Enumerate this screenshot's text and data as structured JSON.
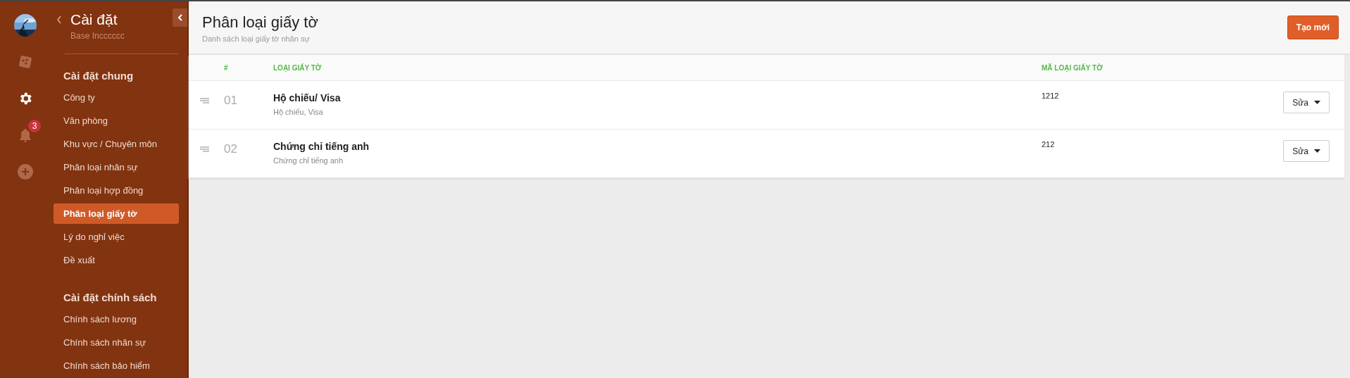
{
  "rail": {
    "items": [
      {
        "kind": "avatar",
        "selected": false
      },
      {
        "kind": "apps",
        "selected": false
      },
      {
        "kind": "settings",
        "selected": true
      },
      {
        "kind": "bell",
        "selected": false,
        "badge": "3"
      },
      {
        "kind": "add",
        "selected": false
      }
    ]
  },
  "sidebar": {
    "title": "Cài đặt",
    "subtitle": "Base Incccccc",
    "sections": [
      {
        "title": "Cài đặt chung",
        "items": [
          {
            "label": "Công ty",
            "selected": false
          },
          {
            "label": "Văn phòng",
            "selected": false
          },
          {
            "label": "Khu vực / Chuyên môn",
            "selected": false
          },
          {
            "label": "Phân loại nhân sự",
            "selected": false
          },
          {
            "label": "Phân loại hợp đồng",
            "selected": false
          },
          {
            "label": "Phân loại giấy tờ",
            "selected": true
          },
          {
            "label": "Lý do nghỉ việc",
            "selected": false
          },
          {
            "label": "Đề xuất",
            "selected": false
          }
        ]
      },
      {
        "title": "Cài đặt chính sách",
        "items": [
          {
            "label": "Chính sách lương",
            "selected": false
          },
          {
            "label": "Chính sách nhân sự",
            "selected": false
          },
          {
            "label": "Chính sách bảo hiểm",
            "selected": false
          }
        ]
      }
    ]
  },
  "header": {
    "title": "Phân loại giấy tờ",
    "subtitle": "Danh sách loại giấy tờ nhân sự",
    "button": "Tạo mới"
  },
  "table": {
    "columns": [
      "#",
      "LOẠI GIẤY TỜ",
      "MÃ LOẠI GIẤY TỜ"
    ],
    "rows": [
      {
        "index": "01",
        "name": "Hộ chiếu/ Visa",
        "description": "Hộ chiếu, Visa",
        "code": "1212",
        "action": "Sửa"
      },
      {
        "index": "02",
        "name": "Chứng chỉ tiếng anh",
        "description": "Chứng chỉ tiếng anh",
        "code": "212",
        "action": "Sửa"
      }
    ]
  }
}
